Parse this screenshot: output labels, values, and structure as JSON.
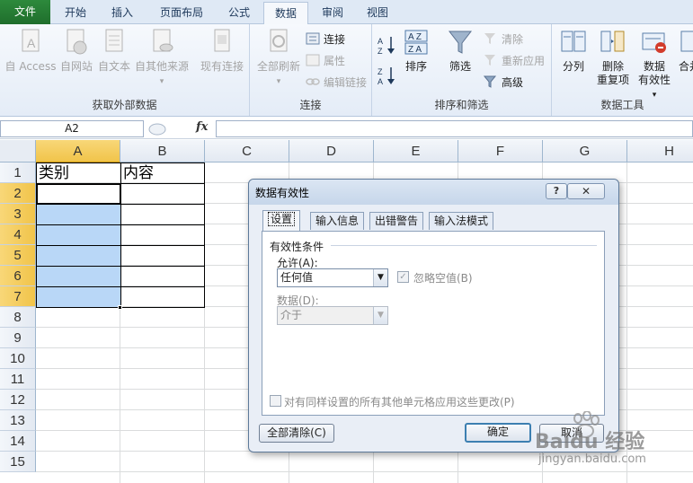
{
  "ribbon_tabs": [
    {
      "label": "文件",
      "left": 0
    },
    {
      "label": "开始"
    },
    {
      "label": "插入"
    },
    {
      "label": "页面布局"
    },
    {
      "label": "公式"
    },
    {
      "label": "数据"
    },
    {
      "label": "审阅"
    },
    {
      "label": "视图"
    }
  ],
  "groups": {
    "external": {
      "label": "获取外部数据",
      "buttons": [
        "自 Access",
        "自网站",
        "自文本",
        "自其他来源",
        "现有连接"
      ]
    },
    "connections": {
      "label": "连接",
      "refresh_all": "全部刷新",
      "connections_btn": "连接",
      "properties": "属性",
      "edit_links": "编辑链接"
    },
    "sort_filter": {
      "label": "排序和筛选",
      "sort": "排序",
      "filter": "筛选",
      "clear": "清除",
      "reapply": "重新应用",
      "advanced": "高级"
    },
    "data_tools": {
      "label": "数据工具",
      "split": "分列",
      "remove_dup_1": "删除",
      "remove_dup_2": "重复项",
      "validation_1": "数据",
      "validation_2": "有效性",
      "consolidate": "合并"
    }
  },
  "formula_bar": {
    "name_box": "A2",
    "fx": "fx",
    "value": ""
  },
  "columns": [
    "A",
    "B",
    "C",
    "D",
    "E",
    "F",
    "G",
    "H"
  ],
  "rows": [
    "1",
    "2",
    "3",
    "4",
    "5",
    "6",
    "7",
    "8",
    "9",
    "10",
    "11",
    "12",
    "13",
    "14",
    "15"
  ],
  "cells": {
    "A1": "类别",
    "B1": "内容"
  },
  "dialog": {
    "title": "数据有效性",
    "help": "?",
    "close": "✕",
    "tabs": [
      "设置",
      "输入信息",
      "出错警告",
      "输入法模式"
    ],
    "section_title": "有效性条件",
    "allow_label": "允许(A):",
    "allow_value": "任何值",
    "ignore_blank": "忽略空值(B)",
    "data_label": "数据(D):",
    "data_value": "介于",
    "apply_all": "对有同样设置的所有其他单元格应用这些更改(P)",
    "clear_all": "全部清除(C)",
    "ok": "确定",
    "cancel": "取消"
  },
  "watermark": {
    "brand": "Baidu 经验",
    "url": "jingyan.baidu.com"
  }
}
